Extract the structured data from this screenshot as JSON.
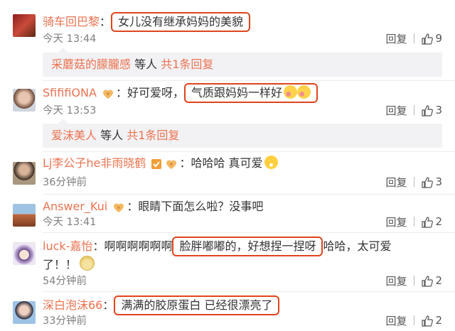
{
  "comments": [
    {
      "user": "骑车回巴黎",
      "sep": "：",
      "text_pre": "",
      "highlight": "女儿没有继承妈妈的美貌",
      "text_post": "",
      "time": "今天 13:44",
      "reply_label": "回复",
      "likes": "9",
      "sub": {
        "name": "采蘑菇的朦朧感",
        "mid": " 等人 ",
        "count": "共1条回复"
      }
    },
    {
      "user": "SfififiONA",
      "sep": "：",
      "text_pre": "好可爱呀，",
      "highlight": "气质跟妈妈一样好",
      "text_post": "",
      "time": "今天 13:53",
      "reply_label": "回复",
      "likes": "3",
      "sub": {
        "name": "爱沫美人",
        "mid": " 等人 ",
        "count": "共1条回复"
      }
    },
    {
      "user": "Lj李公子he非雨晓鹤",
      "sep": "：",
      "text_pre": "哈哈哈 真可爱",
      "time": "36分钟前",
      "reply_label": "回复",
      "likes": "3"
    },
    {
      "user": "Answer_Kui",
      "sep": "：",
      "text_pre": "眼睛下面怎么啦？没事吧",
      "time": "今天 13:41",
      "reply_label": "回复",
      "likes": "2"
    },
    {
      "user": "luck-嘉怡",
      "sep": "：",
      "text_pre": "啊啊啊啊啊啊",
      "highlight": "脸胖嘟嘟的，好想捏一捏呀",
      "text_post": "哈哈，太可爱",
      "line2": "了！！",
      "time": "54分钟前",
      "reply_label": "回复",
      "likes": "2"
    },
    {
      "user": "深白泡沫66",
      "sep": "：",
      "highlight": "满满的胶原蛋白 已经很漂亮了",
      "time": "33分钟前",
      "reply_label": "回复",
      "likes": "2"
    }
  ],
  "colors": {
    "username": "#eb7350",
    "highlight_border": "#e0441d",
    "meta": "#808080"
  }
}
